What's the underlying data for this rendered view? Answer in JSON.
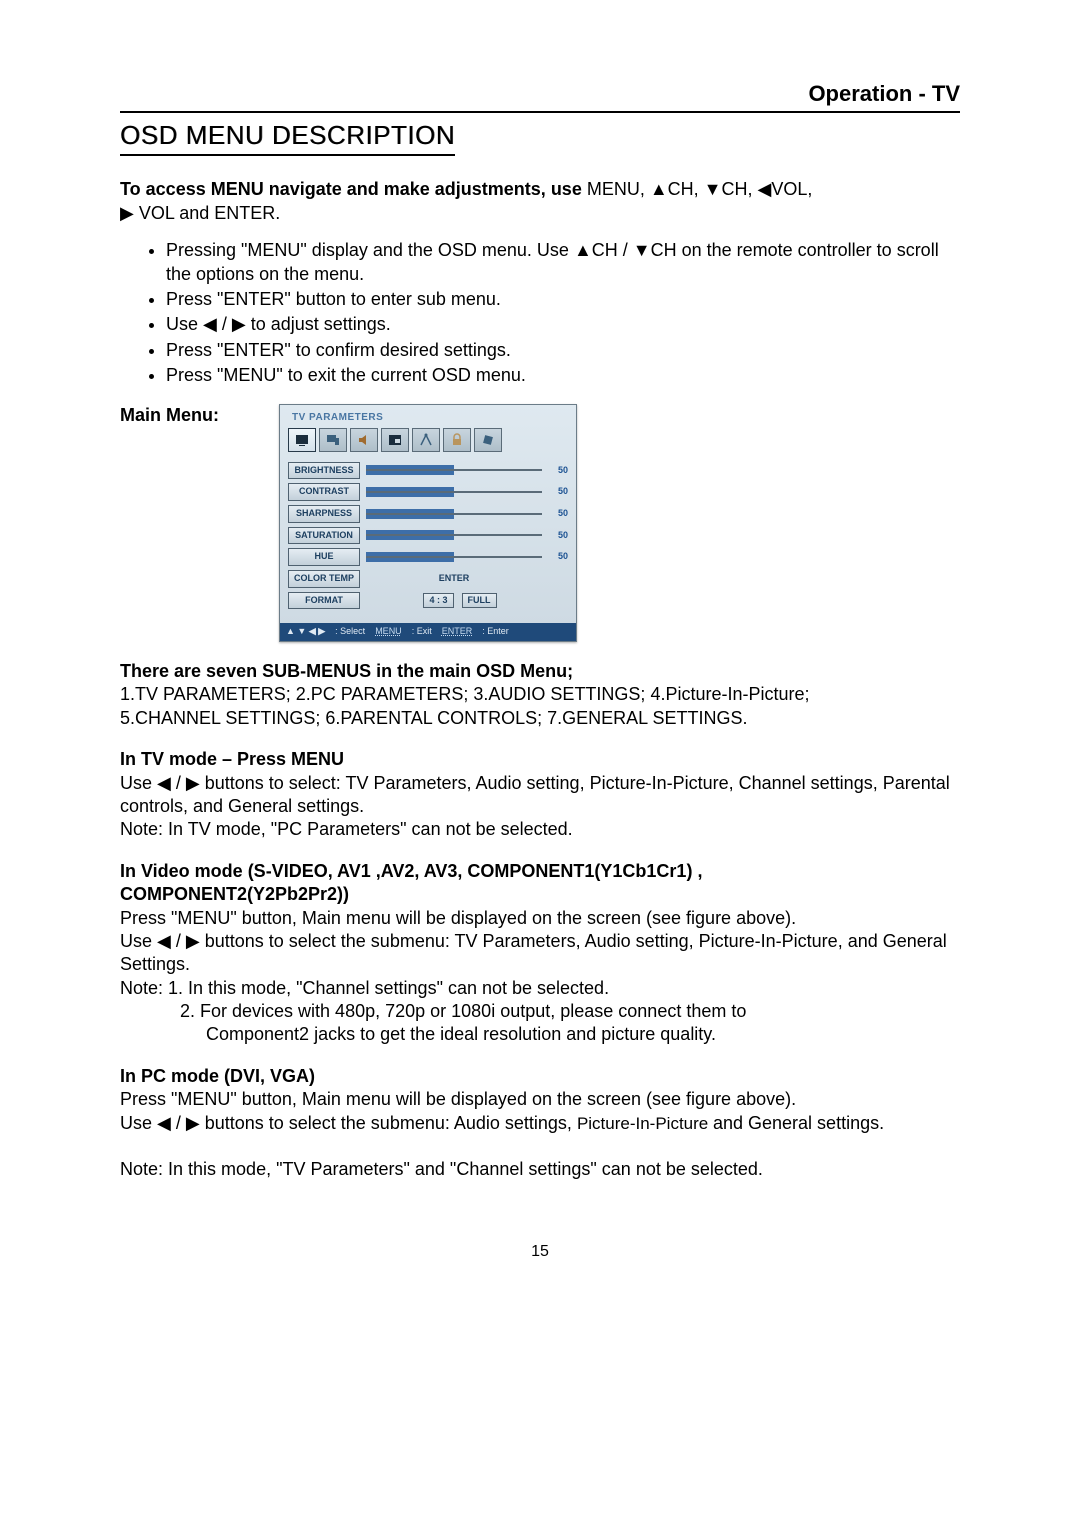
{
  "header": {
    "title": "Operation - TV"
  },
  "section_title": "OSD MENU DESCRIPTION",
  "intro": {
    "bold": "To access MENU navigate and make adjustments, use ",
    "rest_line1": "MENU, ▲CH, ▼CH, ◀VOL,",
    "rest_line2": "▶ VOL and ENTER."
  },
  "bullets": [
    "Pressing \"MENU\" display and the OSD menu. Use ▲CH / ▼CH on the remote controller to scroll the options on the menu.",
    "Press \"ENTER\" button to enter sub menu.",
    "Use ◀ / ▶ to adjust settings.",
    "Press \"ENTER\" to confirm desired settings.",
    "Press \"MENU\" to exit the current OSD menu."
  ],
  "main_menu_label": "Main Menu:",
  "osd": {
    "title": "TV PARAMETERS",
    "rows": [
      {
        "label": "BRIGHTNESS",
        "value": 50
      },
      {
        "label": "CONTRAST",
        "value": 50
      },
      {
        "label": "SHARPNESS",
        "value": 50
      },
      {
        "label": "SATURATION",
        "value": 50
      },
      {
        "label": "HUE",
        "value": 50
      }
    ],
    "color_temp": {
      "label": "COLOR TEMP",
      "value": "ENTER"
    },
    "format": {
      "label": "FORMAT",
      "options": [
        "4 : 3",
        "FULL"
      ]
    },
    "hint": {
      "select": ": Select",
      "menu": "MENU",
      "exit": ": Exit",
      "enter": "ENTER",
      "enter_lbl": ": Enter",
      "arrows": "▲ ▼ ◀ ▶"
    }
  },
  "sub_menus_head": "There are seven SUB-MENUS in the main OSD Menu;",
  "sub_menus_line1": "1.TV PARAMETERS; 2.PC PARAMETERS; 3.AUDIO SETTINGS; 4.Picture-In-Picture;",
  "sub_menus_line2": "5.CHANNEL SETTINGS; 6.PARENTAL CONTROLS; 7.GENERAL SETTINGS.",
  "tv_mode": {
    "head": "In TV mode – Press MENU",
    "p1": "Use ◀ / ▶ buttons to select: TV Parameters, Audio setting, Picture-In-Picture, Channel settings, Parental controls, and General settings.",
    "p2": "Note: In TV mode, \"PC Parameters\" can not be selected."
  },
  "video_mode": {
    "head1": "In Video mode (S-VIDEO, AV1 ,AV2, AV3, COMPONENT1(Y1Cb1Cr1) ,",
    "head2": "COMPONENT2(Y2Pb2Pr2))",
    "p1": "Press \"MENU\" button, Main menu will be displayed on the screen (see figure above).",
    "p2": "Use   ◀ / ▶ buttons to select the submenu: TV Parameters, Audio setting, Picture-In-Picture, and General Settings.",
    "n1": "Note: 1. In this mode, \"Channel settings\" can not be selected.",
    "n2": "2. For devices with 480p, 720p or 1080i output, please connect them to",
    "n3": "Component2 jacks to get the ideal resolution and picture quality."
  },
  "pc_mode": {
    "head": "In PC mode (DVI, VGA)",
    "p1": "Press \"MENU\" button, Main menu will be displayed on the screen (see figure above).",
    "p2a": "Use ◀ / ▶ buttons to select the submenu:  Audio settings, ",
    "p2b": "Picture-In-Picture ",
    "p2c": "and General settings.",
    "note": "Note: In this mode, \"TV Parameters\" and \"Channel settings\" can not be selected."
  },
  "page_number": "15"
}
